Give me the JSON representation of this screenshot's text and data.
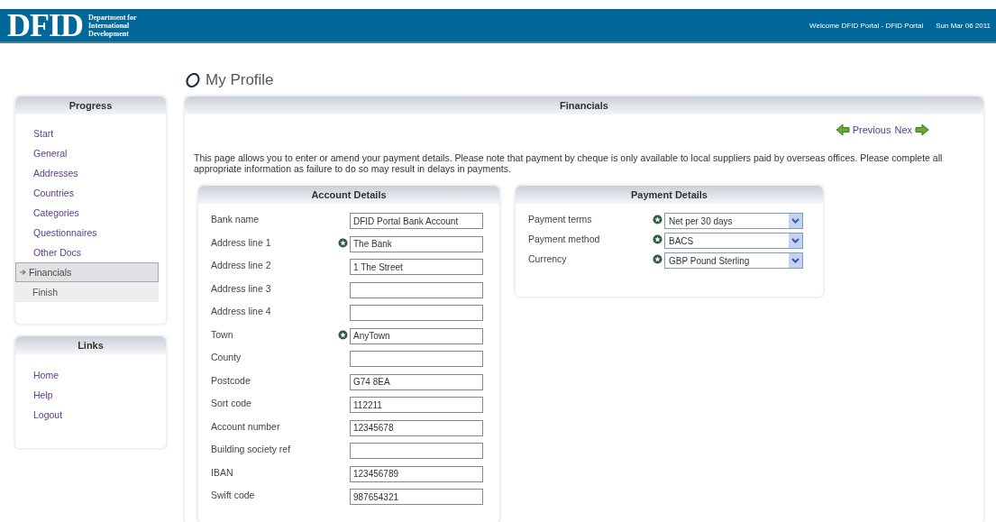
{
  "header": {
    "logo_text": "DFID",
    "logo_subtitle": [
      "Department for",
      "International",
      "Development"
    ],
    "welcome": "Welcome DFID Portal - DFID Portal",
    "date": "Sun Mar 06 2011"
  },
  "page_title": "My Profile",
  "progress": {
    "title": "Progress",
    "items": [
      {
        "label": "Start",
        "selected": false,
        "disabled": false
      },
      {
        "label": "General",
        "selected": false,
        "disabled": false
      },
      {
        "label": "Addresses",
        "selected": false,
        "disabled": false
      },
      {
        "label": "Countries",
        "selected": false,
        "disabled": false
      },
      {
        "label": "Categories",
        "selected": false,
        "disabled": false
      },
      {
        "label": "Questionnaires",
        "selected": false,
        "disabled": false
      },
      {
        "label": "Other Docs",
        "selected": false,
        "disabled": false
      },
      {
        "label": "Financials",
        "selected": true,
        "disabled": false
      },
      {
        "label": "Finish",
        "selected": false,
        "disabled": true
      }
    ]
  },
  "links": {
    "title": "Links",
    "items": [
      "Home",
      "Help",
      "Logout"
    ]
  },
  "main": {
    "title": "Financials",
    "previous": "Previous",
    "next": "Nex",
    "intro": "This page allows you to enter or amend your payment details. Please note that payment by cheque is only available to local suppliers paid by overseas offices. Please complete all appropriate information as failure to do so may result in delays in payments.",
    "account_details": {
      "title": "Account Details",
      "fields": [
        {
          "label": "Bank name",
          "value": "DFID Portal Bank Account",
          "required": false
        },
        {
          "label": "Address line 1",
          "value": "The Bank",
          "required": true
        },
        {
          "label": "Address line 2",
          "value": "1 The Street",
          "required": false
        },
        {
          "label": "Address line 3",
          "required": false
        },
        {
          "label": "Address line 4",
          "required": false
        },
        {
          "label": "Town",
          "value": "AnyTown",
          "required": true
        },
        {
          "label": "County",
          "required": false
        },
        {
          "label": "Postcode",
          "value": "G74 8EA",
          "required": false
        },
        {
          "label": "Sort code",
          "value": "112211",
          "required": false
        },
        {
          "label": "Account number",
          "value": "12345678",
          "required": false
        },
        {
          "label": "Building society ref",
          "required": false
        },
        {
          "label": "IBAN",
          "value": "123456789",
          "required": false
        },
        {
          "label": "Swift code",
          "value": "987654321",
          "required": false
        }
      ]
    },
    "payment_details": {
      "title": "Payment Details",
      "fields": [
        {
          "label": "Payment terms",
          "value": "Net per 30 days",
          "required": true
        },
        {
          "label": "Payment method",
          "value": "BACS",
          "required": true
        },
        {
          "label": "Currency",
          "value": "GBP Pound Sterling",
          "required": true
        }
      ]
    }
  }
}
